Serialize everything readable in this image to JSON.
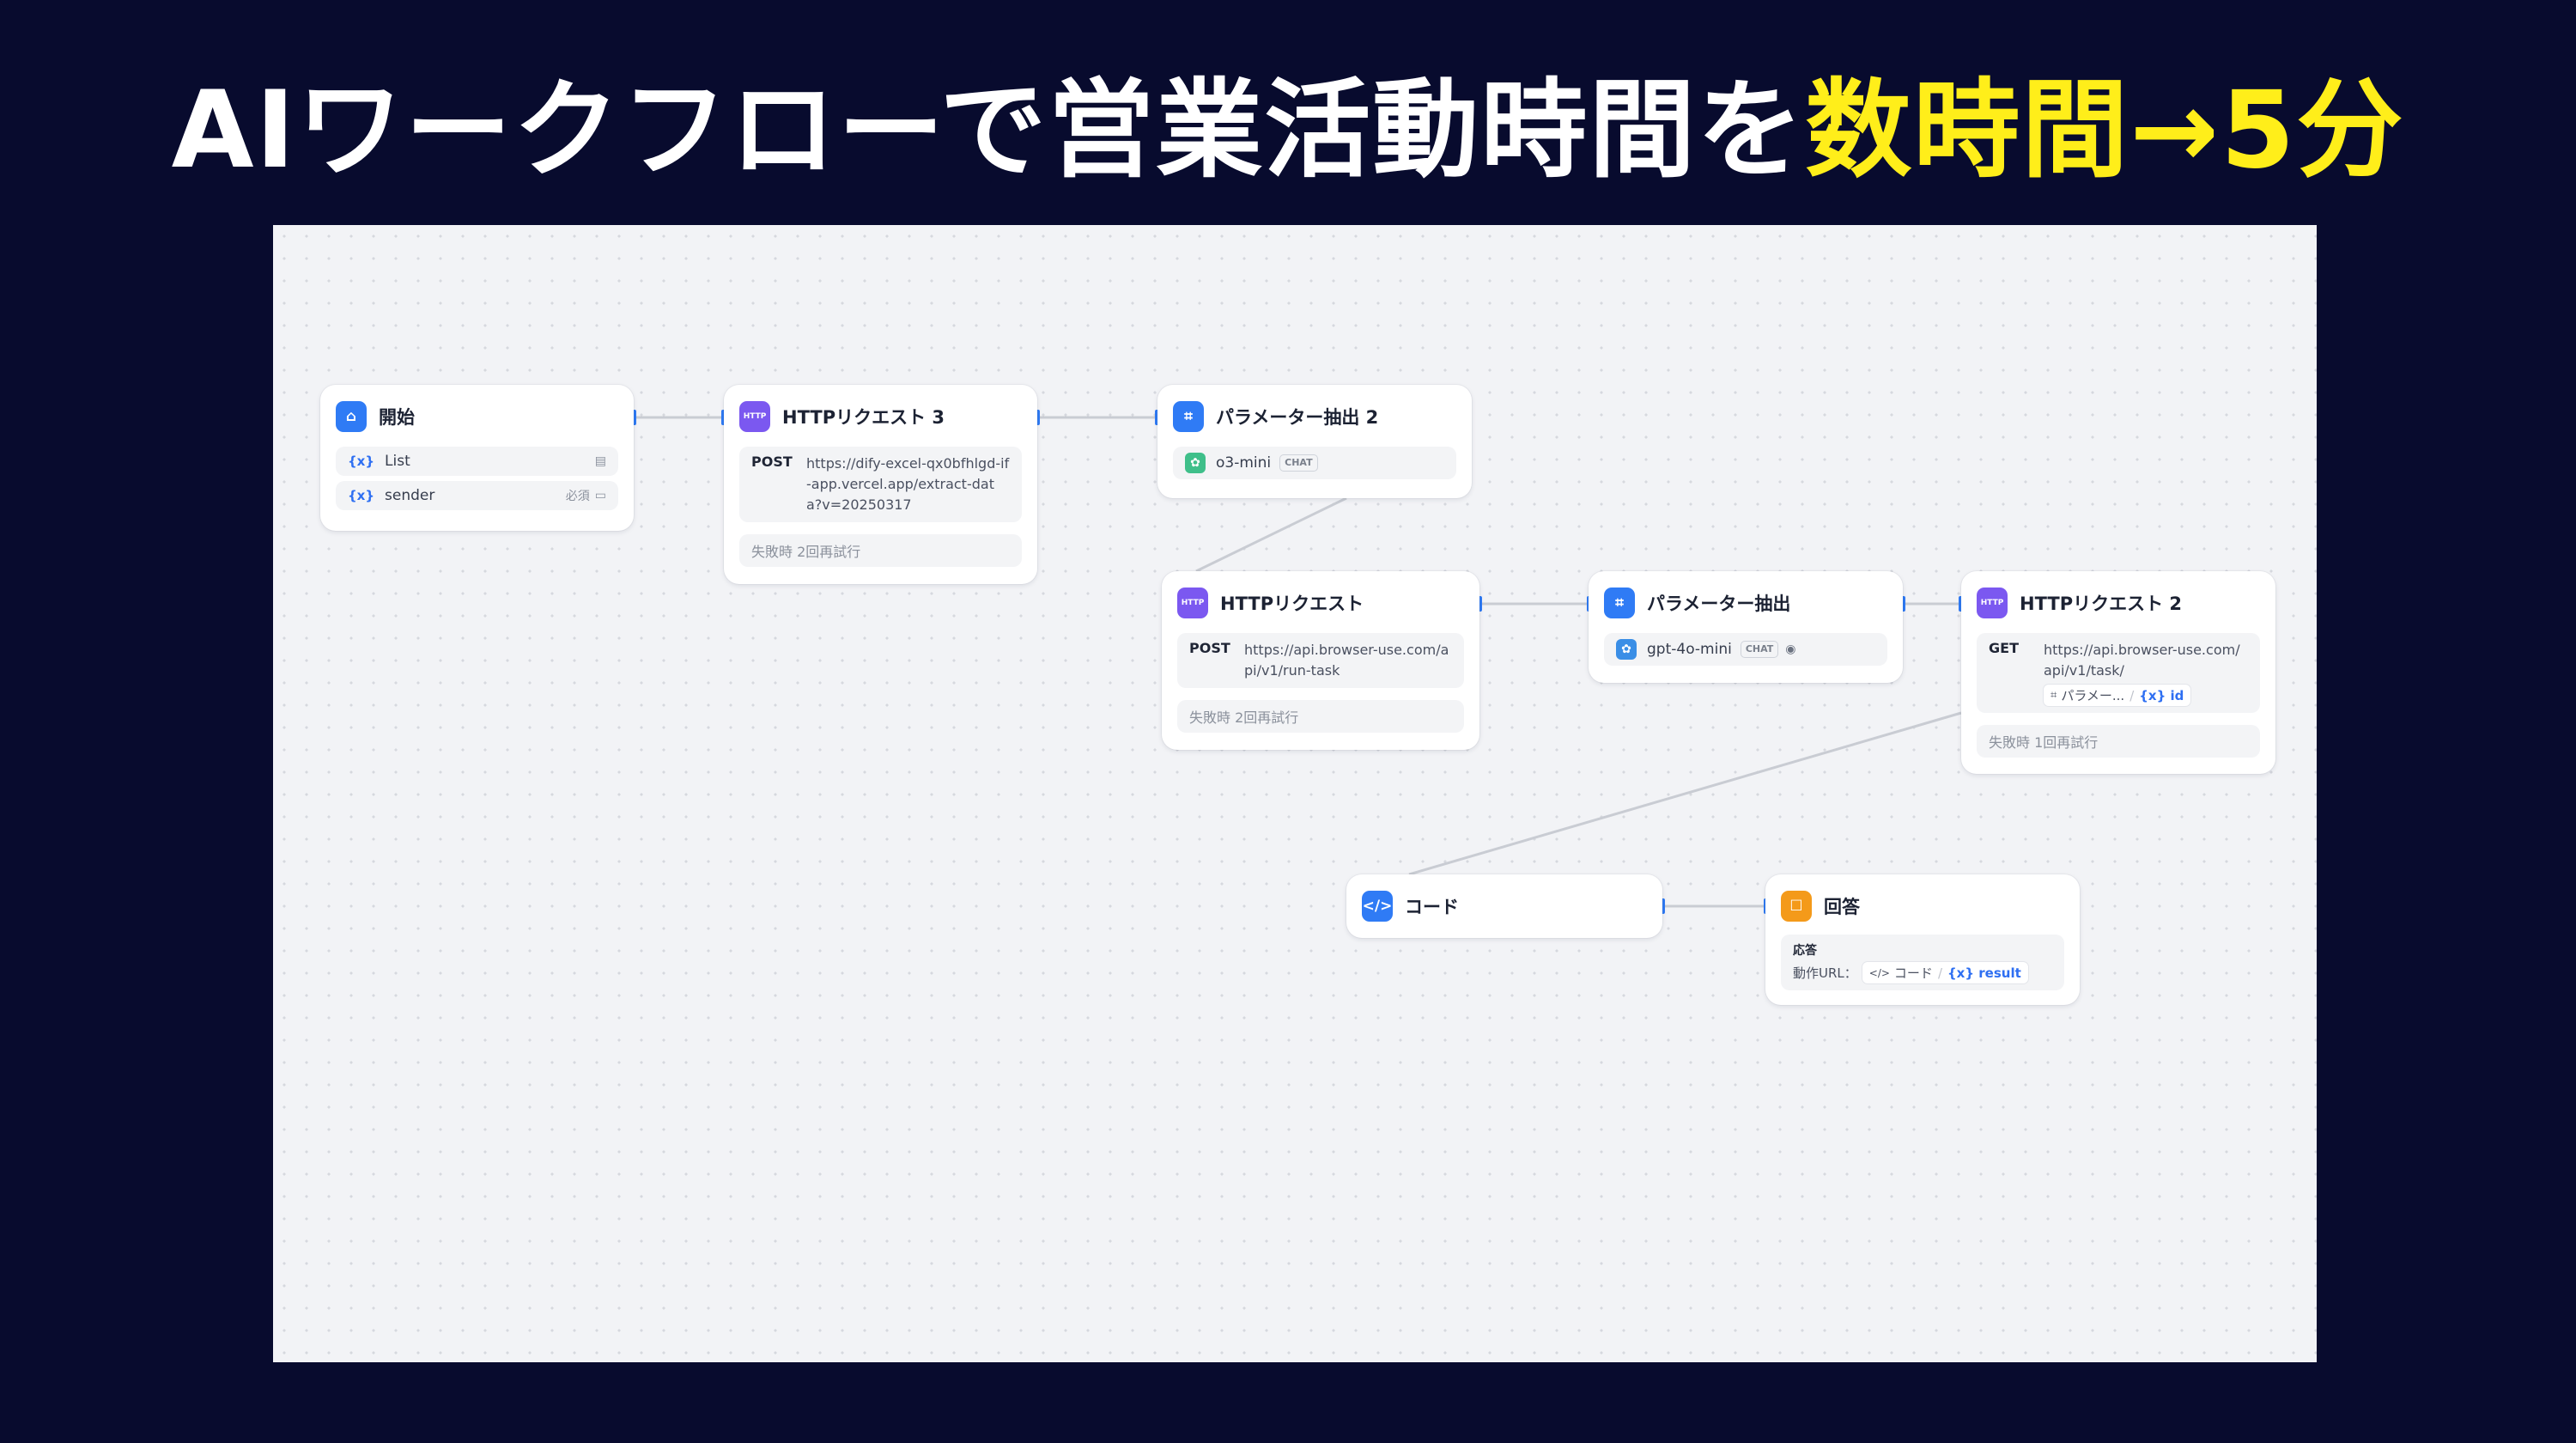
{
  "slide": {
    "title_main": "AIワークフローで営業活動時間を",
    "title_highlight": "数時間→5分"
  },
  "nodes": {
    "start": {
      "title": "開始",
      "vars": [
        {
          "symbol": "{x}",
          "name": "List",
          "extra": ""
        },
        {
          "symbol": "{x}",
          "name": "sender",
          "extra": "必須"
        }
      ]
    },
    "http3": {
      "title": "HTTPリクエスト 3",
      "method": "POST",
      "url": "https://dify-excel-qx0bfhlgd-if-app.vercel.app/extract-data?v=20250317",
      "retry": "失敗時 2回再試行"
    },
    "param2": {
      "title": "パラメーター抽出 2",
      "model": "o3-mini",
      "mode": "CHAT"
    },
    "http1": {
      "title": "HTTPリクエスト",
      "method": "POST",
      "url": "https://api.browser-use.com/api/v1/run-task",
      "retry": "失敗時 2回再試行"
    },
    "param1": {
      "title": "パラメーター抽出",
      "model": "gpt-4o-mini",
      "mode": "CHAT"
    },
    "http2": {
      "title": "HTTPリクエスト 2",
      "method": "GET",
      "url": "https://api.browser-use.com/api/v1/task/",
      "chip_node": "パラメー...",
      "chip_var": "id",
      "retry": "失敗時 1回再試行"
    },
    "code": {
      "title": "コード"
    },
    "answer": {
      "title": "回答",
      "label": "応答",
      "line_label": "動作URL：",
      "chip_node": "コード",
      "chip_var": "result"
    }
  },
  "colors": {
    "background": "#080b2e",
    "title": "#ffffff",
    "highlight": "#ffee1a",
    "accent": "#2f7bf5",
    "http_icon": "#7b58f0",
    "answer_icon": "#f49a1a"
  },
  "icons": {
    "start": "home-icon",
    "http": "http-icon",
    "param": "parameter-extractor-icon",
    "code": "code-icon",
    "answer": "answer-icon"
  }
}
